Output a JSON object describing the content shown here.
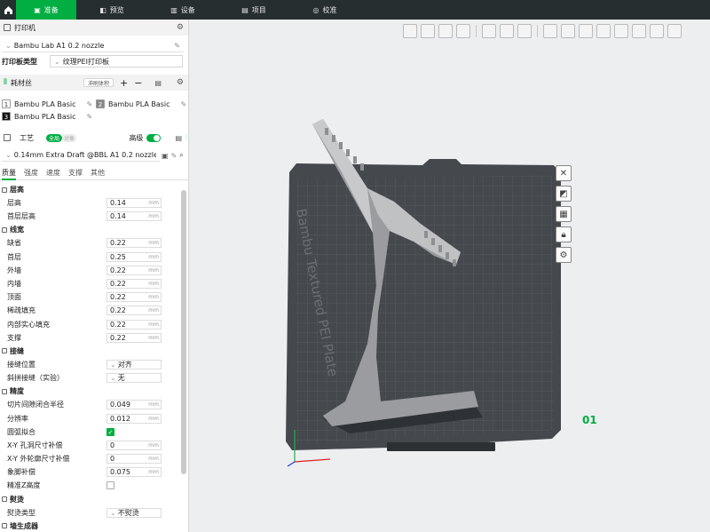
{
  "topbar": {
    "tabs": [
      {
        "label": "准备",
        "icon": "prepare-icon",
        "active": true
      },
      {
        "label": "预览",
        "icon": "preview-icon",
        "active": false
      },
      {
        "label": "设备",
        "icon": "device-icon",
        "active": false
      },
      {
        "label": "项目",
        "icon": "project-icon",
        "active": false
      },
      {
        "label": "校准",
        "icon": "calibrate-icon",
        "active": false
      }
    ]
  },
  "printer": {
    "section_title": "打印机",
    "name": "Bambu Lab A1 0.2 nozzle",
    "plate_type_label": "打印板类型",
    "plate_type_value": "纹理PEI打印板"
  },
  "filament": {
    "section_title": "耗材丝",
    "flush_button": "冲刷体积",
    "slots": [
      {
        "num": "1",
        "name": "Bambu PLA Basic",
        "color": "#ffffff"
      },
      {
        "num": "2",
        "name": "Bambu PLA Basic",
        "color": "#888888"
      },
      {
        "num": "3",
        "name": "Bambu PLA Basic",
        "color": "#111111"
      }
    ]
  },
  "process": {
    "section_title": "工艺",
    "global_label": "全局",
    "object_label": "对象",
    "advanced_label": "高级",
    "preset": "0.14mm Extra Draft @BBL A1 0.2 nozzle",
    "subtabs": [
      "质量",
      "强度",
      "速度",
      "支撑",
      "其他"
    ]
  },
  "params": [
    {
      "type": "group",
      "label": "层高"
    },
    {
      "type": "num",
      "label": "层高",
      "value": "0.14",
      "unit": "mm"
    },
    {
      "type": "num",
      "label": "首层层高",
      "value": "0.14",
      "unit": "mm"
    },
    {
      "type": "group",
      "label": "线宽"
    },
    {
      "type": "num",
      "label": "缺省",
      "value": "0.22",
      "unit": "mm"
    },
    {
      "type": "num",
      "label": "首层",
      "value": "0.25",
      "unit": "mm"
    },
    {
      "type": "num",
      "label": "外墙",
      "value": "0.22",
      "unit": "mm"
    },
    {
      "type": "num",
      "label": "内墙",
      "value": "0.22",
      "unit": "mm"
    },
    {
      "type": "num",
      "label": "顶面",
      "value": "0.22",
      "unit": "mm"
    },
    {
      "type": "num",
      "label": "稀疏填充",
      "value": "0.22",
      "unit": "mm"
    },
    {
      "type": "num",
      "label": "内部实心填充",
      "value": "0.22",
      "unit": "mm"
    },
    {
      "type": "num",
      "label": "支撑",
      "value": "0.22",
      "unit": "mm"
    },
    {
      "type": "group",
      "label": "接缝"
    },
    {
      "type": "sel",
      "label": "接缝位置",
      "value": "对齐"
    },
    {
      "type": "sel",
      "label": "斜拼接缝（实验）",
      "value": "无"
    },
    {
      "type": "group",
      "label": "精度"
    },
    {
      "type": "num",
      "label": "切片间隙闭合半径",
      "value": "0.049",
      "unit": "mm"
    },
    {
      "type": "num",
      "label": "分辨率",
      "value": "0.012",
      "unit": "mm"
    },
    {
      "type": "check",
      "label": "圆弧拟合",
      "checked": true
    },
    {
      "type": "num",
      "label": "X-Y 孔洞尺寸补偿",
      "value": "0",
      "unit": "mm"
    },
    {
      "type": "num",
      "label": "X-Y 外轮廓尺寸补偿",
      "value": "0",
      "unit": "mm"
    },
    {
      "type": "num",
      "label": "象脚补偿",
      "value": "0.075",
      "unit": "mm"
    },
    {
      "type": "check",
      "label": "精准Z高度",
      "checked": false
    },
    {
      "type": "group",
      "label": "熨烫"
    },
    {
      "type": "sel",
      "label": "熨烫类型",
      "value": "不熨烫"
    },
    {
      "type": "group",
      "label": "墙生成器"
    }
  ],
  "viewport": {
    "plate_label": "Bambu Textured PEI Plate",
    "plate_number": "01"
  }
}
